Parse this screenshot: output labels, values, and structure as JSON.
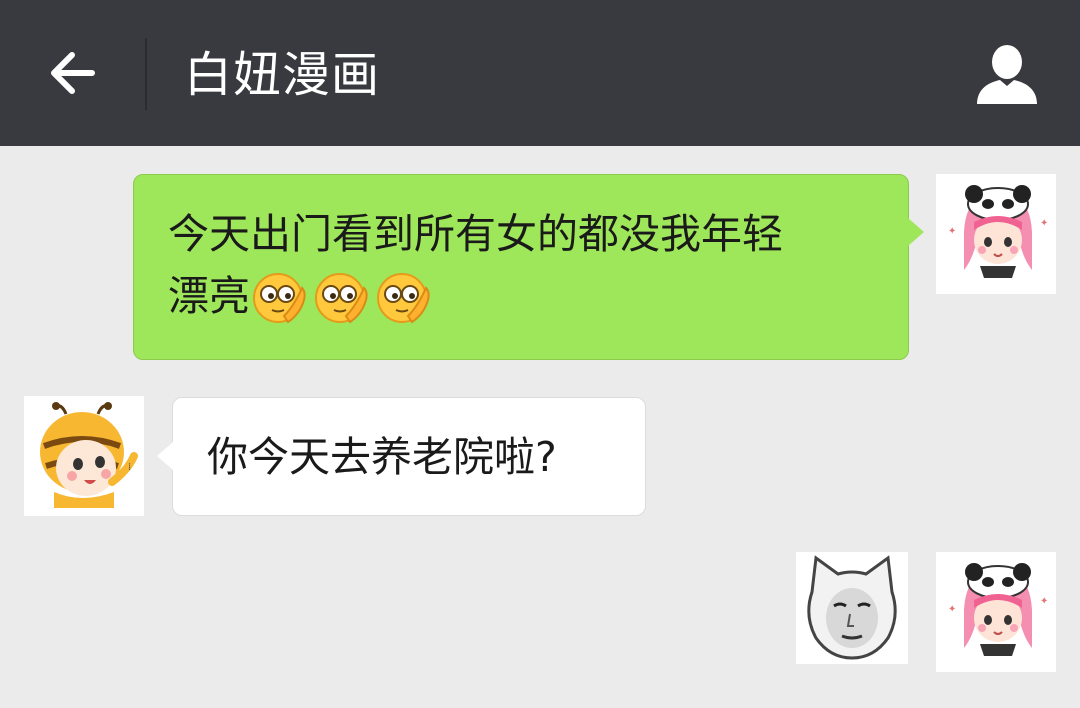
{
  "header": {
    "title": "白妞漫画",
    "back_icon": "arrow-left-icon",
    "profile_icon": "person-icon",
    "background": "#393a3f"
  },
  "messages": [
    {
      "side": "outgoing",
      "text_line1": "今天出门看到所有女的都没我年轻",
      "text_line2": "漂亮",
      "emoji": [
        "thinking-face-emoji",
        "thinking-face-emoji",
        "thinking-face-emoji"
      ],
      "bubble_color": "#9fe75a",
      "avatar": "panda-hat-girl-avatar"
    },
    {
      "side": "incoming",
      "text": "你今天去养老院啦?",
      "bubble_color": "#ffffff",
      "avatar": "bee-costume-kid-avatar"
    },
    {
      "side": "outgoing",
      "sticker": "cat-face-meme-sticker",
      "avatar": "panda-hat-girl-avatar"
    }
  ]
}
